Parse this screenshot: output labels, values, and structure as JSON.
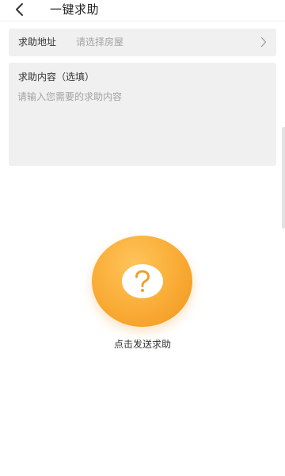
{
  "header": {
    "title": "一键求助",
    "back_icon": "chevron-left-icon"
  },
  "form": {
    "address_label": "求助地址",
    "address_placeholder": "请选择房屋",
    "address_chevron_icon": "chevron-right-icon",
    "content_label": "求助内容（选填）",
    "content_value": "",
    "content_placeholder": "请输入您需要的求助内容"
  },
  "help": {
    "icon": "question-mark-icon",
    "label": "点击发送求助",
    "colors": {
      "button_light": "#ffc45a",
      "button_main": "#f9ab35",
      "button_dark": "#ef961e",
      "icon_bg": "#ffffff"
    }
  }
}
